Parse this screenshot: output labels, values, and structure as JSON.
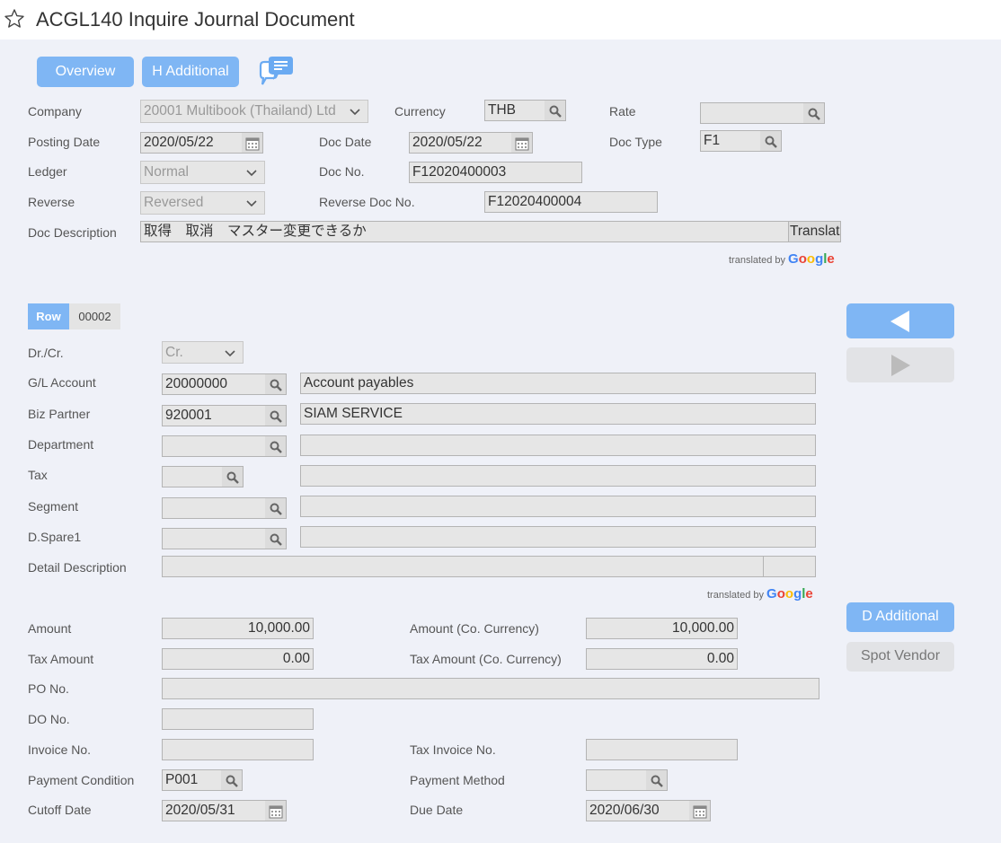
{
  "header": {
    "title": "ACGL140 Inquire Journal Document"
  },
  "top_buttons": {
    "overview": "Overview",
    "h_additional": "H Additional"
  },
  "doc": {
    "company_label": "Company",
    "company_value": "20001 Multibook (Thailand) Ltd",
    "currency_label": "Currency",
    "currency_value": "THB",
    "rate_label": "Rate",
    "rate_value": "",
    "posting_date_label": "Posting Date",
    "posting_date_value": "2020/05/22",
    "doc_date_label": "Doc Date",
    "doc_date_value": "2020/05/22",
    "doc_type_label": "Doc Type",
    "doc_type_value": "F1",
    "ledger_label": "Ledger",
    "ledger_value": "Normal",
    "doc_no_label": "Doc No.",
    "doc_no_value": "F12020400003",
    "reverse_label": "Reverse",
    "reverse_value": "Reversed",
    "reverse_doc_no_label": "Reverse Doc No.",
    "reverse_doc_no_value": "F12020400004",
    "doc_description_label": "Doc Description",
    "doc_description_value": "取得　取消　マスター変更できるか",
    "translate_button": "Translat",
    "translated_by": "translated by",
    "google": "Google"
  },
  "row": {
    "tag": "Row",
    "number": "00002",
    "drcr_label": "Dr./Cr.",
    "drcr_value": "Cr.",
    "gl_account_label": "G/L Account",
    "gl_account_value": "20000000",
    "gl_account_name": "Account payables",
    "biz_partner_label": "Biz Partner",
    "biz_partner_value": "920001",
    "biz_partner_name": "SIAM SERVICE",
    "department_label": "Department",
    "department_value": "",
    "department_name": "",
    "tax_label": "Tax",
    "tax_value": "",
    "tax_name": "",
    "segment_label": "Segment",
    "segment_value": "",
    "segment_name": "",
    "dspare1_label": "D.Spare1",
    "dspare1_value": "",
    "dspare1_name": "",
    "detail_description_label": "Detail Description",
    "detail_description_value": "",
    "translated_by": "translated by",
    "google": "Google",
    "amount_label": "Amount",
    "amount_value": "10,000.00",
    "amount_co_label": "Amount (Co. Currency)",
    "amount_co_value": "10,000.00",
    "tax_amount_label": "Tax Amount",
    "tax_amount_value": "0.00",
    "tax_amount_co_label": "Tax Amount (Co. Currency)",
    "tax_amount_co_value": "0.00",
    "po_no_label": "PO No.",
    "po_no_value": "",
    "do_no_label": "DO No.",
    "do_no_value": "",
    "invoice_no_label": "Invoice No.",
    "invoice_no_value": "",
    "tax_invoice_no_label": "Tax Invoice No.",
    "tax_invoice_no_value": "",
    "payment_condition_label": "Payment Condition",
    "payment_condition_value": "P001",
    "payment_method_label": "Payment Method",
    "payment_method_value": "",
    "cutoff_date_label": "Cutoff Date",
    "cutoff_date_value": "2020/05/31",
    "due_date_label": "Due Date",
    "due_date_value": "2020/06/30"
  },
  "side_buttons": {
    "d_additional": "D Additional",
    "spot_vendor": "Spot Vendor"
  },
  "icons": {
    "favorite": "star-outline-icon",
    "chat": "chat-bubbles-icon",
    "lookup": "search-icon",
    "calendar": "calendar-icon",
    "dropdown": "chevron-down-icon",
    "prev": "triangle-left-icon",
    "next": "triangle-right-icon"
  },
  "colors": {
    "accent": "#7fb6f4",
    "background": "#eff1f8",
    "field": "#e6e6e6",
    "google_blue": "#4285f4",
    "google_red": "#ea4335",
    "google_yellow": "#fbbc05",
    "google_green": "#34a853"
  }
}
